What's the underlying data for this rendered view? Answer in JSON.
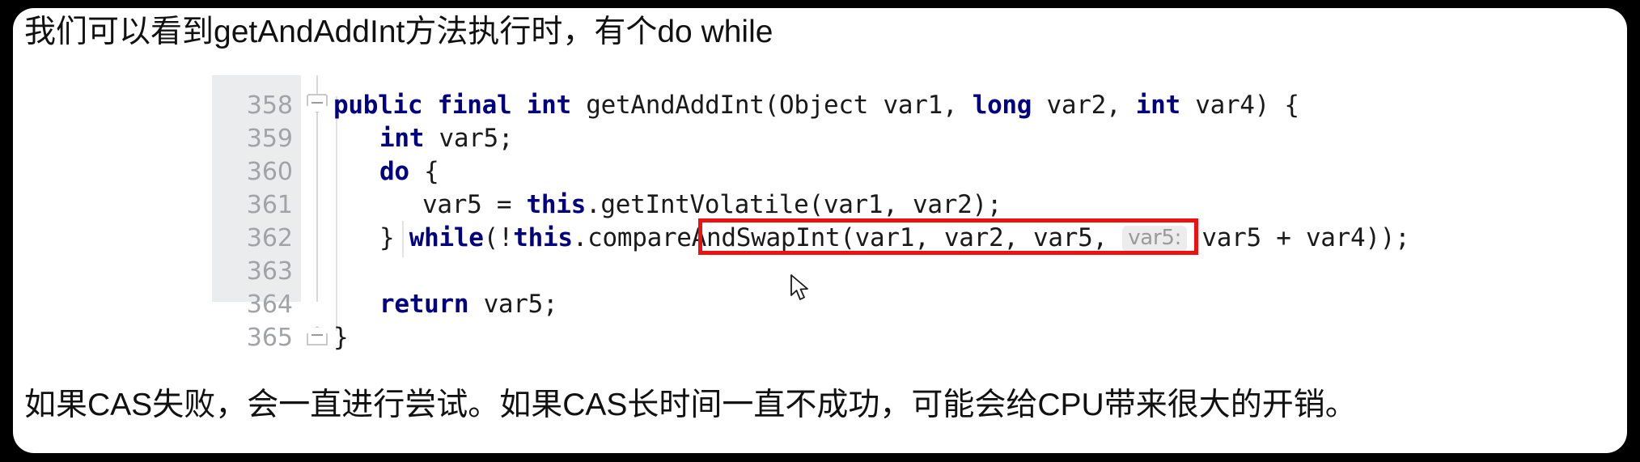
{
  "frame": {
    "border_color": "#000000",
    "card_background": "#ffffff"
  },
  "caption_top": {
    "text": "我们可以看到getAndAddInt方法执行时，有个do while"
  },
  "caption_bottom": {
    "text": "如果CAS失败，会一直进行尝试。如果CAS长时间一直不成功，可能会给CPU带来很大的开销。"
  },
  "editor": {
    "gutter_background": "#ebecee",
    "line_number_color": "#a1a3a6",
    "keyword_color": "#000080",
    "text_color": "#1a1a1a",
    "line_numbers": [
      "358",
      "359",
      "360",
      "361",
      "362",
      "363",
      "364",
      "365"
    ],
    "lines": [
      {
        "number": "358",
        "indent": 0,
        "tokens": [
          {
            "t": "public",
            "k": true
          },
          {
            "t": " ",
            "k": false
          },
          {
            "t": "final",
            "k": true
          },
          {
            "t": " ",
            "k": false
          },
          {
            "t": "int",
            "k": true
          },
          {
            "t": " getAndAddInt(Object var1, ",
            "k": false
          },
          {
            "t": "long",
            "k": true
          },
          {
            "t": " var2, ",
            "k": false
          },
          {
            "t": "int",
            "k": true
          },
          {
            "t": " var4) {",
            "k": false
          }
        ]
      },
      {
        "number": "359",
        "indent": 1,
        "tokens": [
          {
            "t": "int",
            "k": true
          },
          {
            "t": " var5;",
            "k": false
          }
        ]
      },
      {
        "number": "360",
        "indent": 1,
        "tokens": [
          {
            "t": "do",
            "k": true
          },
          {
            "t": " {",
            "k": false
          }
        ]
      },
      {
        "number": "361",
        "indent": 2,
        "tokens": [
          {
            "t": "var5 = ",
            "k": false
          },
          {
            "t": "this",
            "k": true
          },
          {
            "t": ".getIntVolatile(var1, var2);",
            "k": false
          }
        ]
      },
      {
        "number": "362",
        "indent": 1,
        "tokens": [
          {
            "t": "} ",
            "k": false
          },
          {
            "t": "while",
            "k": true
          },
          {
            "t": "(!",
            "k": false
          },
          {
            "t": "this",
            "k": true
          },
          {
            "t": ".compareAndSwapInt(var1, var2, var5, ",
            "k": false
          },
          {
            "t": "HINT",
            "k": false
          },
          {
            "t": " var5 + var4));",
            "k": false
          }
        ]
      },
      {
        "number": "363",
        "indent": 0,
        "tokens": []
      },
      {
        "number": "364",
        "indent": 1,
        "tokens": [
          {
            "t": "return",
            "k": true
          },
          {
            "t": " var5;",
            "k": false
          }
        ]
      },
      {
        "number": "365",
        "indent": 0,
        "tokens": [
          {
            "t": "}",
            "k": false
          }
        ]
      }
    ],
    "parameter_hint": {
      "label": "var5:",
      "background": "#ececed",
      "color": "#9a9a9a"
    },
    "highlight_box": {
      "color": "#ee1111",
      "target_line": "361"
    },
    "fold_markers": {
      "glyph": "minus",
      "top_line": "358",
      "bottom_line": "365"
    }
  }
}
